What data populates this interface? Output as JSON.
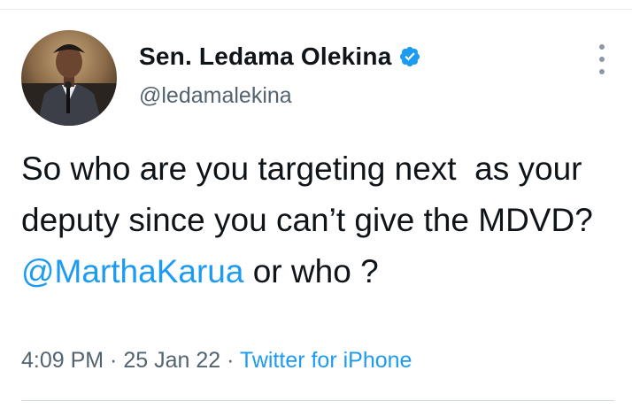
{
  "tweet": {
    "author": {
      "display_name": "Sen. Ledama Olekina",
      "handle": "@ledamalekina",
      "verified": true
    },
    "text_before_mention": "So who are you targeting next  as your deputy since you can’t give the MDVD? ",
    "mention": "@MarthaKarua",
    "text_after_mention": " or who ?",
    "time": "4:09 PM",
    "separator_1": " · ",
    "date": "25 Jan 22",
    "separator_2": " · ",
    "source": "Twitter for iPhone"
  },
  "colors": {
    "text": "#0f1419",
    "secondary": "#536471",
    "link": "#1d9bf0",
    "verified": "#1d9bf0"
  },
  "icons": {
    "verified": "verified-badge-icon",
    "more": "more-vertical-icon"
  }
}
